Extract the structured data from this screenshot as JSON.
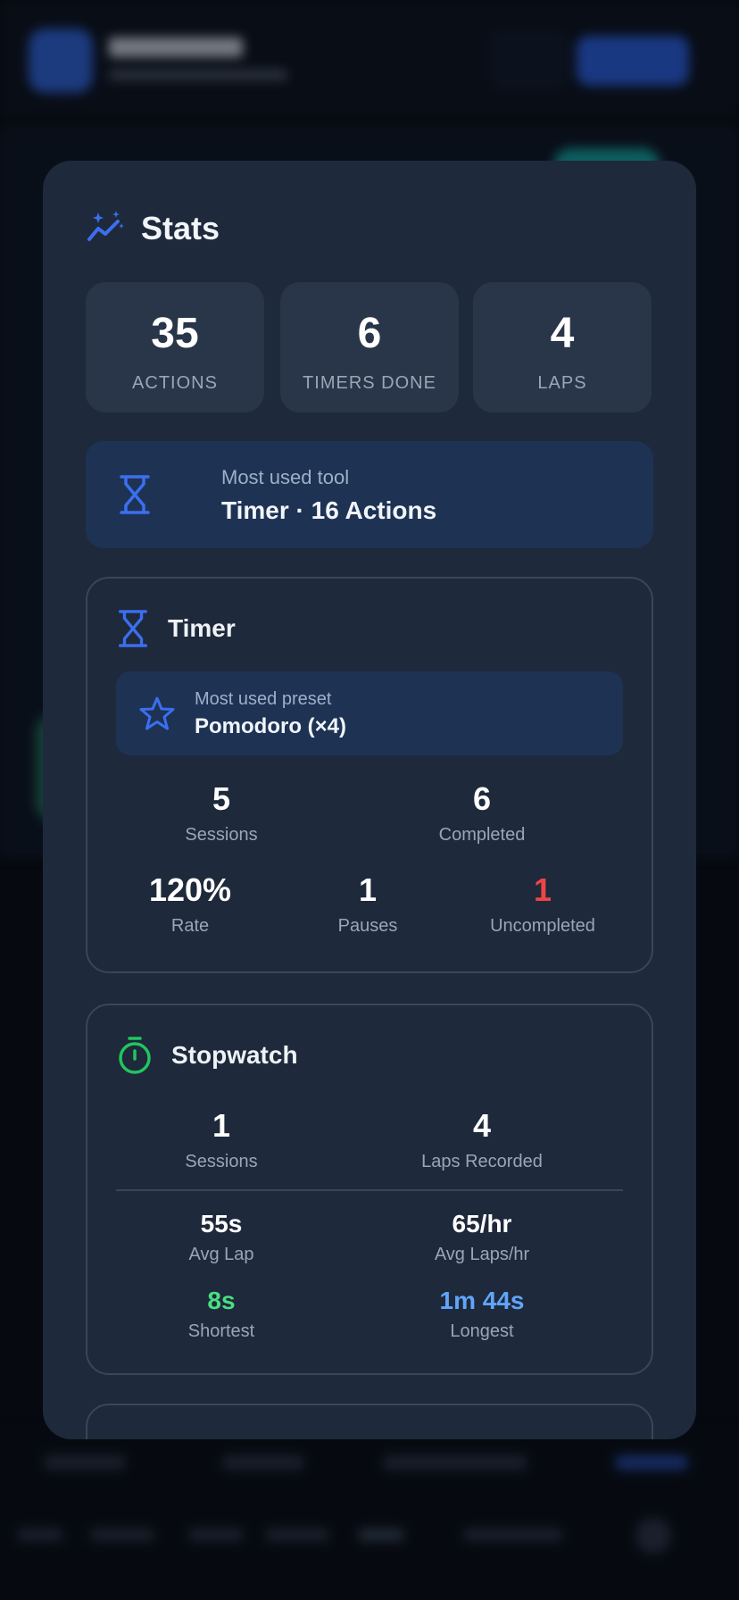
{
  "modal": {
    "title": "Stats",
    "summary": [
      {
        "value": "35",
        "label": "ACTIONS"
      },
      {
        "value": "6",
        "label": "TIMERS DONE"
      },
      {
        "value": "4",
        "label": "LAPS"
      }
    ],
    "most_used_tool": {
      "caption": "Most used tool",
      "value": "Timer · 16 Actions"
    },
    "timer": {
      "title": "Timer",
      "preset_caption": "Most used preset",
      "preset_value": "Pomodoro (×4)",
      "sessions": {
        "value": "5",
        "label": "Sessions"
      },
      "completed": {
        "value": "6",
        "label": "Completed"
      },
      "rate": {
        "value": "120%",
        "label": "Rate"
      },
      "pauses": {
        "value": "1",
        "label": "Pauses"
      },
      "uncompleted": {
        "value": "1",
        "label": "Uncompleted"
      }
    },
    "stopwatch": {
      "title": "Stopwatch",
      "sessions": {
        "value": "1",
        "label": "Sessions"
      },
      "laps_recorded": {
        "value": "4",
        "label": "Laps Recorded"
      },
      "avg_lap": {
        "value": "55s",
        "label": "Avg Lap"
      },
      "avg_laps_hr": {
        "value": "65/hr",
        "label": "Avg Laps/hr"
      },
      "shortest": {
        "value": "8s",
        "label": "Shortest"
      },
      "longest": {
        "value": "1m 44s",
        "label": "Longest"
      }
    }
  },
  "colors": {
    "accent_blue": "#3b6ff0",
    "stopwatch_green": "#22c55e",
    "shortest_green": "#4ade80",
    "longest_blue": "#60a5fa",
    "uncompleted_red": "#ef4444"
  },
  "icons": {
    "stats": "sparkle-chart-icon",
    "tool": "hourglass-icon",
    "preset": "star-icon",
    "stopwatch": "stopwatch-icon"
  }
}
